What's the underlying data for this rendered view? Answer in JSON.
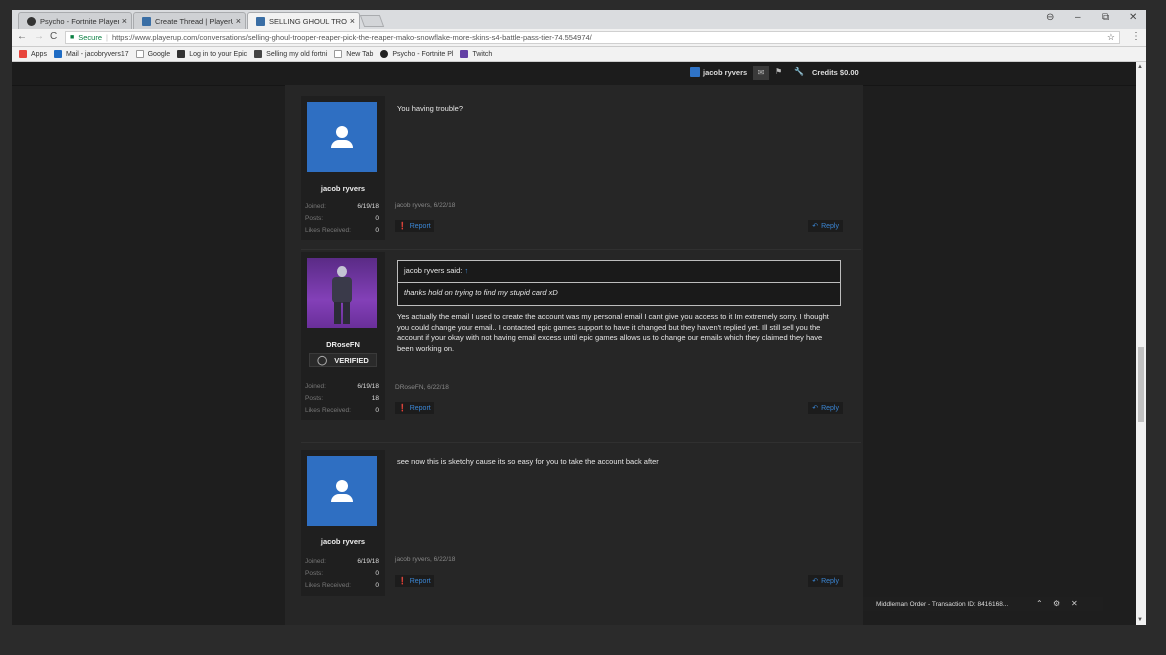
{
  "tabs": [
    {
      "title": "Psycho - Fortnite Player S",
      "close": "×"
    },
    {
      "title": "Create Thread | PlayerUp",
      "close": "×"
    },
    {
      "title": "SELLING GHOUL TROOPE",
      "close": "×"
    }
  ],
  "window_controls": {
    "profile": "⊖",
    "minimize": "–",
    "restore": "⧉",
    "close": "✕"
  },
  "address": {
    "back": "←",
    "forward": "→",
    "reload": "C",
    "secure_label": "Secure",
    "url": "https://www.playerup.com/conversations/selling-ghoul-trooper-reaper-pick-the-reaper-mako-snowflake-more-skins-s4-battle-pass-tier-74.554974/",
    "star": "☆",
    "menu": "⋮"
  },
  "bookmarks": [
    {
      "label": "Apps",
      "color": "#e8453c"
    },
    {
      "label": "Mail - jacobryvers17",
      "color": "#1f6cc4"
    },
    {
      "label": "Google",
      "color": "#ffffff"
    },
    {
      "label": "Log in to your Epic",
      "color": "#333333"
    },
    {
      "label": "Selling my old fortni",
      "color": "#444444"
    },
    {
      "label": "New Tab",
      "color": "#ffffff"
    },
    {
      "label": "Psycho - Fortnite Pl",
      "color": "#222222"
    },
    {
      "label": "Twitch",
      "color": "#6441a5"
    }
  ],
  "topnav": {
    "username": "jacob ryvers",
    "credits": "Credits $0.00"
  },
  "posts": [
    {
      "author": "jacob ryvers",
      "joined_label": "Joined:",
      "joined": "6/19/18",
      "posts_label": "Posts:",
      "posts": "0",
      "likes_label": "Likes Received:",
      "likes": "0",
      "message": "You having trouble?",
      "meta": "jacob ryvers, 6/22/18",
      "report": "Report",
      "reply": "Reply"
    },
    {
      "author": "DRoseFN",
      "verified": "VERIFIED",
      "joined_label": "Joined:",
      "joined": "6/19/18",
      "posts_label": "Posts:",
      "posts": "18",
      "likes_label": "Likes Received:",
      "likes": "0",
      "quote_header": "jacob ryvers said:",
      "quote_arrow": "↑",
      "quote_body": "thanks hold on trying to find my stupid card xD",
      "message": "Yes actually the email I used to create the account was my personal email I cant give you access to it Im extremely sorry. I thought you could change your email.. I contacted epic games support to have it changed but they haven't replied yet. Ill still sell you the account if your okay with not having email excess until epic games allows us to change our emails which they claimed they have been working on.",
      "meta": "DRoseFN, 6/22/18",
      "report": "Report",
      "reply": "Reply"
    },
    {
      "author": "jacob ryvers",
      "joined_label": "Joined:",
      "joined": "6/19/18",
      "posts_label": "Posts:",
      "posts": "0",
      "likes_label": "Likes Received:",
      "likes": "0",
      "message": "see now this is sketchy cause its so easy for you to take the account back after",
      "meta": "jacob ryvers, 6/22/18",
      "report": "Report",
      "reply": "Reply"
    }
  ],
  "middleman": {
    "label": "Middleman Order - Transaction ID: 8416168...",
    "up": "⌃",
    "gear": "⚙",
    "close": "✕"
  },
  "colors": {
    "accent": "#2f73c6",
    "link": "#3b86d4",
    "secure": "#0b8043"
  }
}
